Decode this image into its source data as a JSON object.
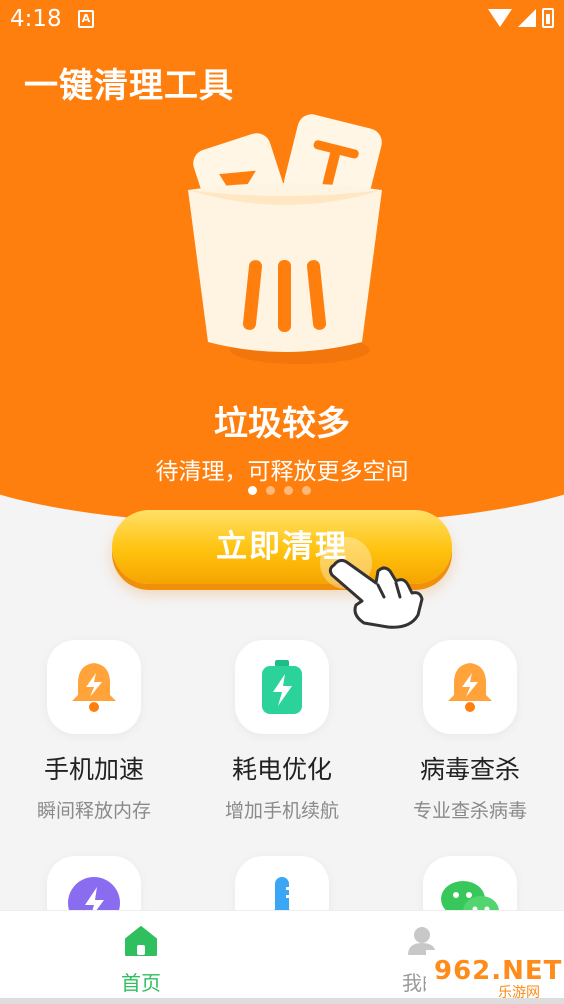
{
  "status_bar": {
    "time": "4:18",
    "notice_icon": "A"
  },
  "header": {
    "title": "一键清理工具"
  },
  "hero": {
    "headline": "垃圾较多",
    "subline": "待清理，可释放更多空间",
    "page_dots": 4,
    "active_dot": 1
  },
  "clean_button": {
    "label": "立即清理"
  },
  "tools": [
    {
      "title": "手机加速",
      "subtitle": "瞬间释放内存",
      "icon": "bell-lightning-icon"
    },
    {
      "title": "耗电优化",
      "subtitle": "增加手机续航",
      "icon": "battery-charge-icon"
    },
    {
      "title": "病毒查杀",
      "subtitle": "专业查杀病毒",
      "icon": "bell-lightning-icon"
    },
    {
      "icon": "lightning-circle-icon"
    },
    {
      "icon": "thermometer-icon"
    },
    {
      "icon": "wechat-icon"
    }
  ],
  "tabbar": {
    "home_label": "首页",
    "mine_label": "我的"
  },
  "watermark": {
    "text": "962.NET",
    "sub": "乐游网"
  },
  "colors": {
    "brand_orange": "#ff7f0e",
    "button_yellow": "#ffc20e",
    "active_tab_green": "#2fbf5f"
  }
}
